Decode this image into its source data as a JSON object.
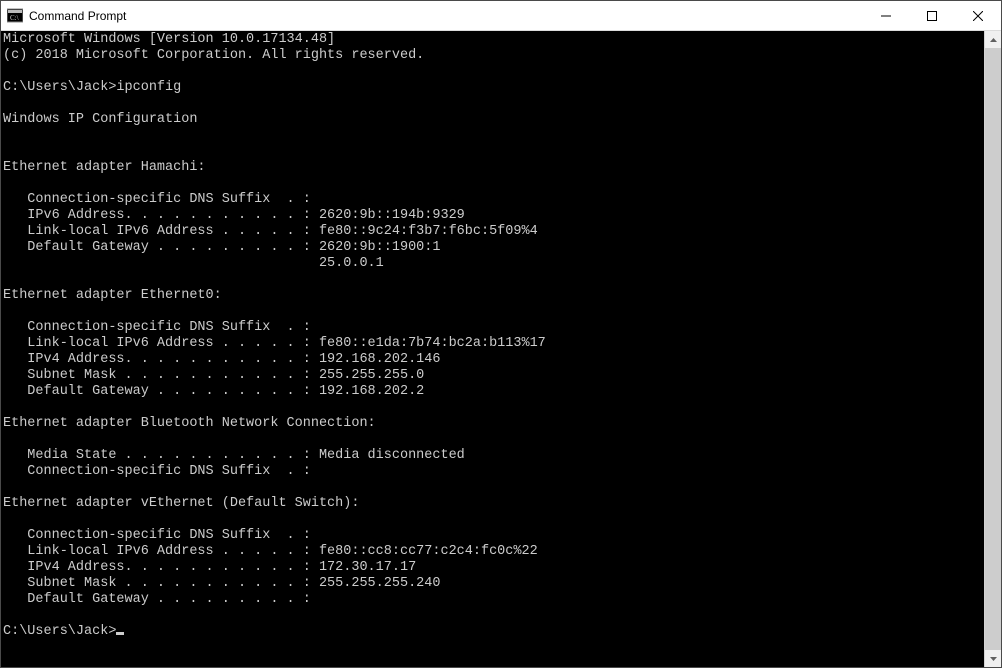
{
  "window": {
    "title": "Command Prompt"
  },
  "terminal": {
    "prompt1": "C:\\Users\\Jack>",
    "command1": "ipconfig",
    "prompt2": "C:\\Users\\Jack>",
    "banner": {
      "line1": "Microsoft Windows [Version 10.0.17134.48]",
      "line2": "(c) 2018 Microsoft Corporation. All rights reserved."
    },
    "ipconfig": {
      "header": "Windows IP Configuration",
      "adapters": [
        {
          "title": "Ethernet adapter Hamachi:",
          "rows": [
            {
              "label": "Connection-specific DNS Suffix  . :",
              "value": ""
            },
            {
              "label": "IPv6 Address. . . . . . . . . . . :",
              "value": "2620:9b::194b:9329"
            },
            {
              "label": "Link-local IPv6 Address . . . . . :",
              "value": "fe80::9c24:f3b7:f6bc:5f09%4"
            },
            {
              "label": "Default Gateway . . . . . . . . . :",
              "value": "2620:9b::1900:1"
            },
            {
              "label": "                                   ",
              "value": "25.0.0.1"
            }
          ]
        },
        {
          "title": "Ethernet adapter Ethernet0:",
          "rows": [
            {
              "label": "Connection-specific DNS Suffix  . :",
              "value": ""
            },
            {
              "label": "Link-local IPv6 Address . . . . . :",
              "value": "fe80::e1da:7b74:bc2a:b113%17"
            },
            {
              "label": "IPv4 Address. . . . . . . . . . . :",
              "value": "192.168.202.146"
            },
            {
              "label": "Subnet Mask . . . . . . . . . . . :",
              "value": "255.255.255.0"
            },
            {
              "label": "Default Gateway . . . . . . . . . :",
              "value": "192.168.202.2"
            }
          ]
        },
        {
          "title": "Ethernet adapter Bluetooth Network Connection:",
          "rows": [
            {
              "label": "Media State . . . . . . . . . . . :",
              "value": "Media disconnected"
            },
            {
              "label": "Connection-specific DNS Suffix  . :",
              "value": ""
            }
          ]
        },
        {
          "title": "Ethernet adapter vEthernet (Default Switch):",
          "rows": [
            {
              "label": "Connection-specific DNS Suffix  . :",
              "value": ""
            },
            {
              "label": "Link-local IPv6 Address . . . . . :",
              "value": "fe80::cc8:cc77:c2c4:fc0c%22"
            },
            {
              "label": "IPv4 Address. . . . . . . . . . . :",
              "value": "172.30.17.17"
            },
            {
              "label": "Subnet Mask . . . . . . . . . . . :",
              "value": "255.255.255.240"
            },
            {
              "label": "Default Gateway . . . . . . . . . :",
              "value": ""
            }
          ]
        }
      ]
    }
  }
}
